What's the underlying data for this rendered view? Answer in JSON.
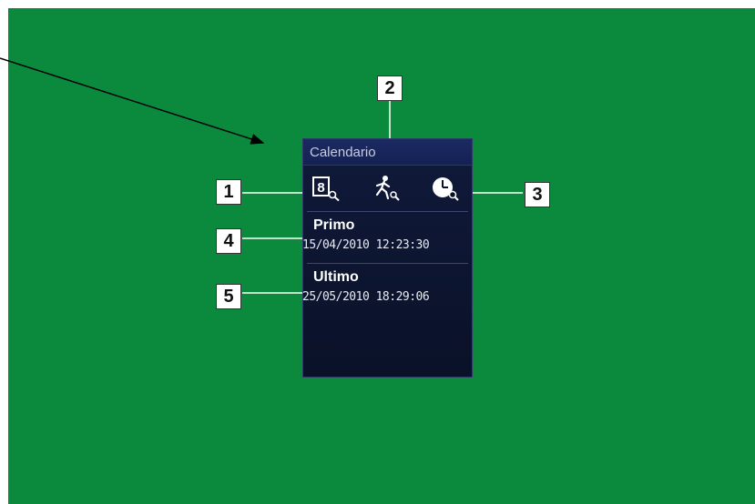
{
  "panel": {
    "title": "Calendario",
    "icons": [
      "calendar-search-icon",
      "running-figure-search-icon",
      "clock-search-icon"
    ],
    "first": {
      "label": "Primo",
      "value": "15/04/2010 12:23:30"
    },
    "last": {
      "label": "Ultimo",
      "value": "25/05/2010 18:29:06"
    }
  },
  "callouts": {
    "c1": "1",
    "c2": "2",
    "c3": "3",
    "c4": "4",
    "c5": "5"
  },
  "colors": {
    "background": "#0b8a3e",
    "panel": "#0a1128",
    "header": "#1b2a63"
  }
}
